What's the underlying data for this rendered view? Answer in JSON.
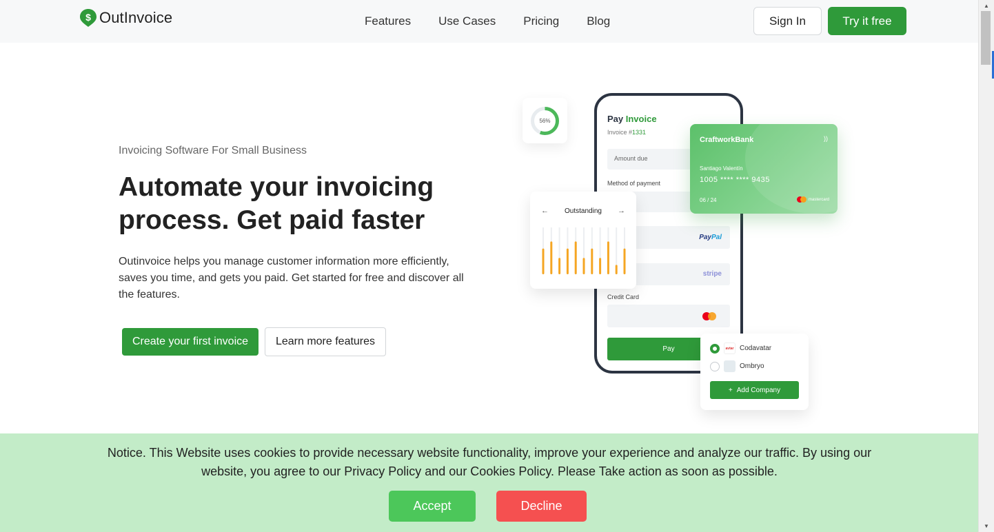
{
  "nav": {
    "logo_text": "OutInvoice",
    "links": [
      "Features",
      "Use Cases",
      "Pricing",
      "Blog"
    ],
    "sign_in": "Sign In",
    "try_free": "Try it free"
  },
  "hero": {
    "eyebrow": "Invoicing Software For Small Business",
    "headline": "Automate your invoicing process. Get paid faster",
    "description": "Outinvoice helps you manage customer information more efficiently, saves you time, and gets you paid. Get started for free and discover all the features.",
    "primary_button": "Create your first invoice",
    "secondary_button": "Learn more features"
  },
  "illustration": {
    "progress_label": "56%",
    "progress_value": 0.56,
    "pay_title_a": "Pay ",
    "pay_title_b": "Invoice",
    "invoice_prefix": "Invoice #",
    "invoice_number": "1331",
    "amount_due": "Amount due",
    "method_of_payment": "Method of payment",
    "paypal_a": "Pay",
    "paypal_b": "Pal",
    "stripe": "stripe",
    "credit_card": "Credit Card",
    "pay_button": "Pay",
    "outstanding": {
      "title": "Outstanding",
      "left_arrow": "←",
      "right_arrow": "→",
      "bars": [
        0.55,
        0.7,
        0.35,
        0.55,
        0.7,
        0.35,
        0.55,
        0.35,
        0.7,
        0.2,
        0.55
      ]
    },
    "bank_card": {
      "bank": "CraftworkBank",
      "holder": "Santiago Valentín",
      "number": "1005  ****  ****  9435",
      "expiry": "06 / 24",
      "brand": "mastercard",
      "contactless": "))"
    },
    "companies": [
      {
        "name": "Codavatar",
        "selected": true,
        "logo_text": "avtar"
      },
      {
        "name": "Ombryo",
        "selected": false,
        "logo_text": ""
      }
    ],
    "add_company": "Add Company",
    "add_icon": "+"
  },
  "cookie": {
    "text": "Notice. This Website uses cookies to provide necessary website functionality, improve your experience and analyze our traffic. By using our website, you agree to our Privacy Policy and our Cookies Policy. Please Take action as soon as possible.",
    "accept": "Accept",
    "decline": "Decline"
  },
  "scrollbar": {
    "up": "▲",
    "down": "▼"
  },
  "colors": {
    "brand_green": "#2f9a3a",
    "accept_green": "#4cc75a",
    "decline_red": "#f55050",
    "cookie_bg": "#c3ecc8",
    "bar_orange": "#f5a623"
  }
}
